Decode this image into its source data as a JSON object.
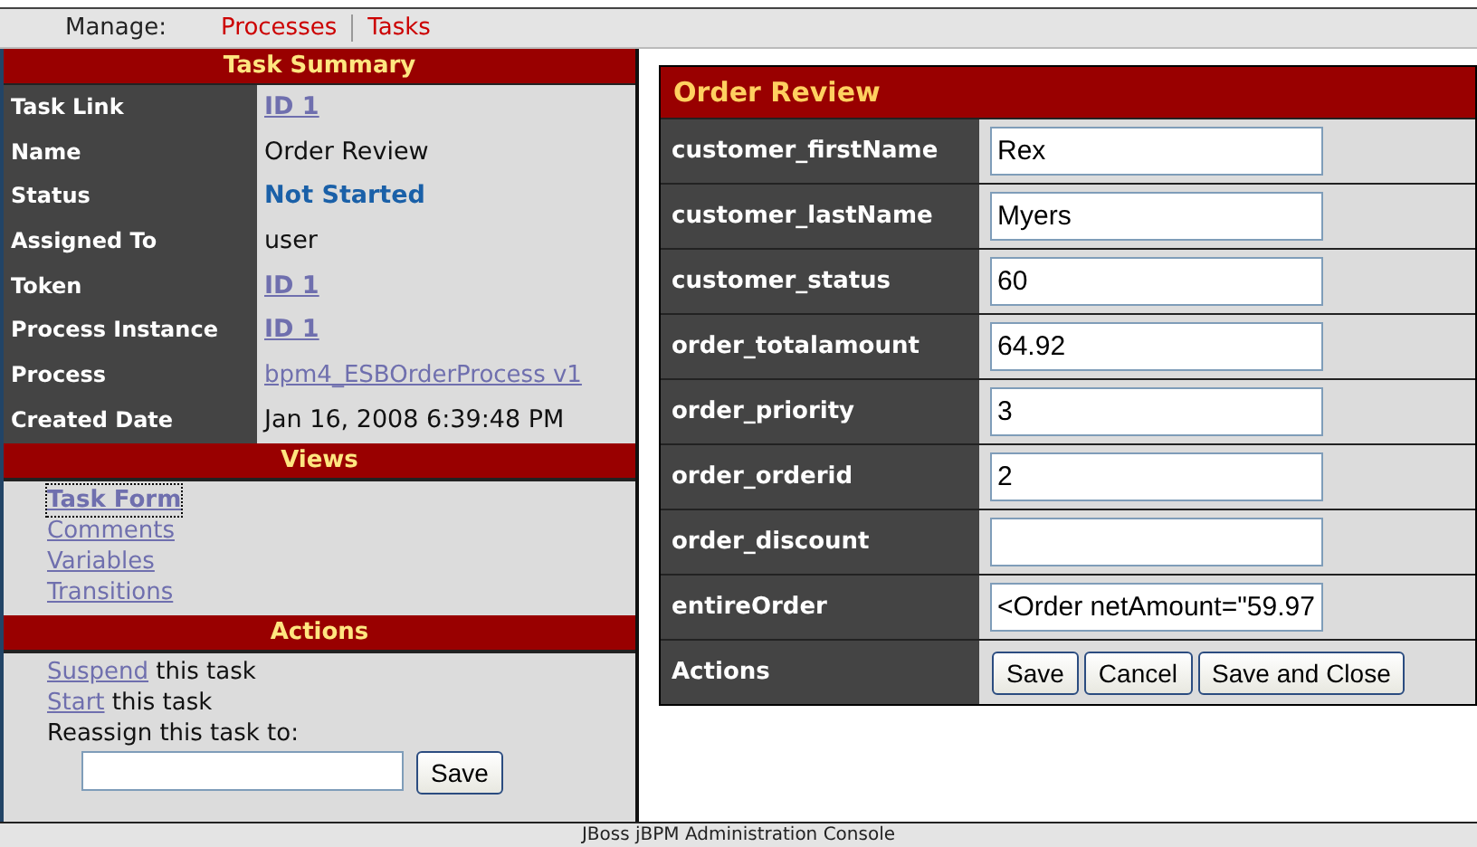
{
  "nav": {
    "label": "Manage:",
    "links": [
      "Processes",
      "Tasks"
    ]
  },
  "summary": {
    "title": "Task Summary",
    "rows": [
      {
        "label": "Task Link",
        "value": "ID 1",
        "kind": "id-link"
      },
      {
        "label": "Name",
        "value": "Order Review",
        "kind": "text"
      },
      {
        "label": "Status",
        "value": "Not Started",
        "kind": "status"
      },
      {
        "label": "Assigned To",
        "value": "user",
        "kind": "text"
      },
      {
        "label": "Token",
        "value": "ID 1",
        "kind": "id-link"
      },
      {
        "label": "Process Instance",
        "value": "ID 1",
        "kind": "id-link"
      },
      {
        "label": "Process",
        "value": "bpm4_ESBOrderProcess v1",
        "kind": "link"
      },
      {
        "label": "Created Date",
        "value": "Jan 16, 2008 6:39:48 PM",
        "kind": "text"
      }
    ]
  },
  "views": {
    "title": "Views",
    "items": [
      {
        "label": "Task Form",
        "selected": true
      },
      {
        "label": "Comments",
        "selected": false
      },
      {
        "label": "Variables",
        "selected": false
      },
      {
        "label": "Transitions",
        "selected": false
      }
    ]
  },
  "actions": {
    "title": "Actions",
    "items": [
      {
        "link": "Suspend",
        "text": "this task"
      },
      {
        "link": "Start",
        "text": "this task"
      }
    ],
    "reassign_label": "Reassign this task to:",
    "save_button": "Save"
  },
  "form": {
    "title": "Order Review",
    "fields": [
      {
        "label": "customer_firstName",
        "value": "Rex"
      },
      {
        "label": "customer_lastName",
        "value": "Myers"
      },
      {
        "label": "customer_status",
        "value": "60"
      },
      {
        "label": "order_totalamount",
        "value": "64.92"
      },
      {
        "label": "order_priority",
        "value": "3"
      },
      {
        "label": "order_orderid",
        "value": "2"
      },
      {
        "label": "order_discount"
      },
      {
        "label": "entireOrder",
        "value": "<Order netAmount=\"59.97"
      }
    ],
    "actions_label": "Actions",
    "buttons": [
      "Save",
      "Cancel",
      "Save and Close"
    ]
  },
  "footer": "JBoss jBPM Administration Console"
}
